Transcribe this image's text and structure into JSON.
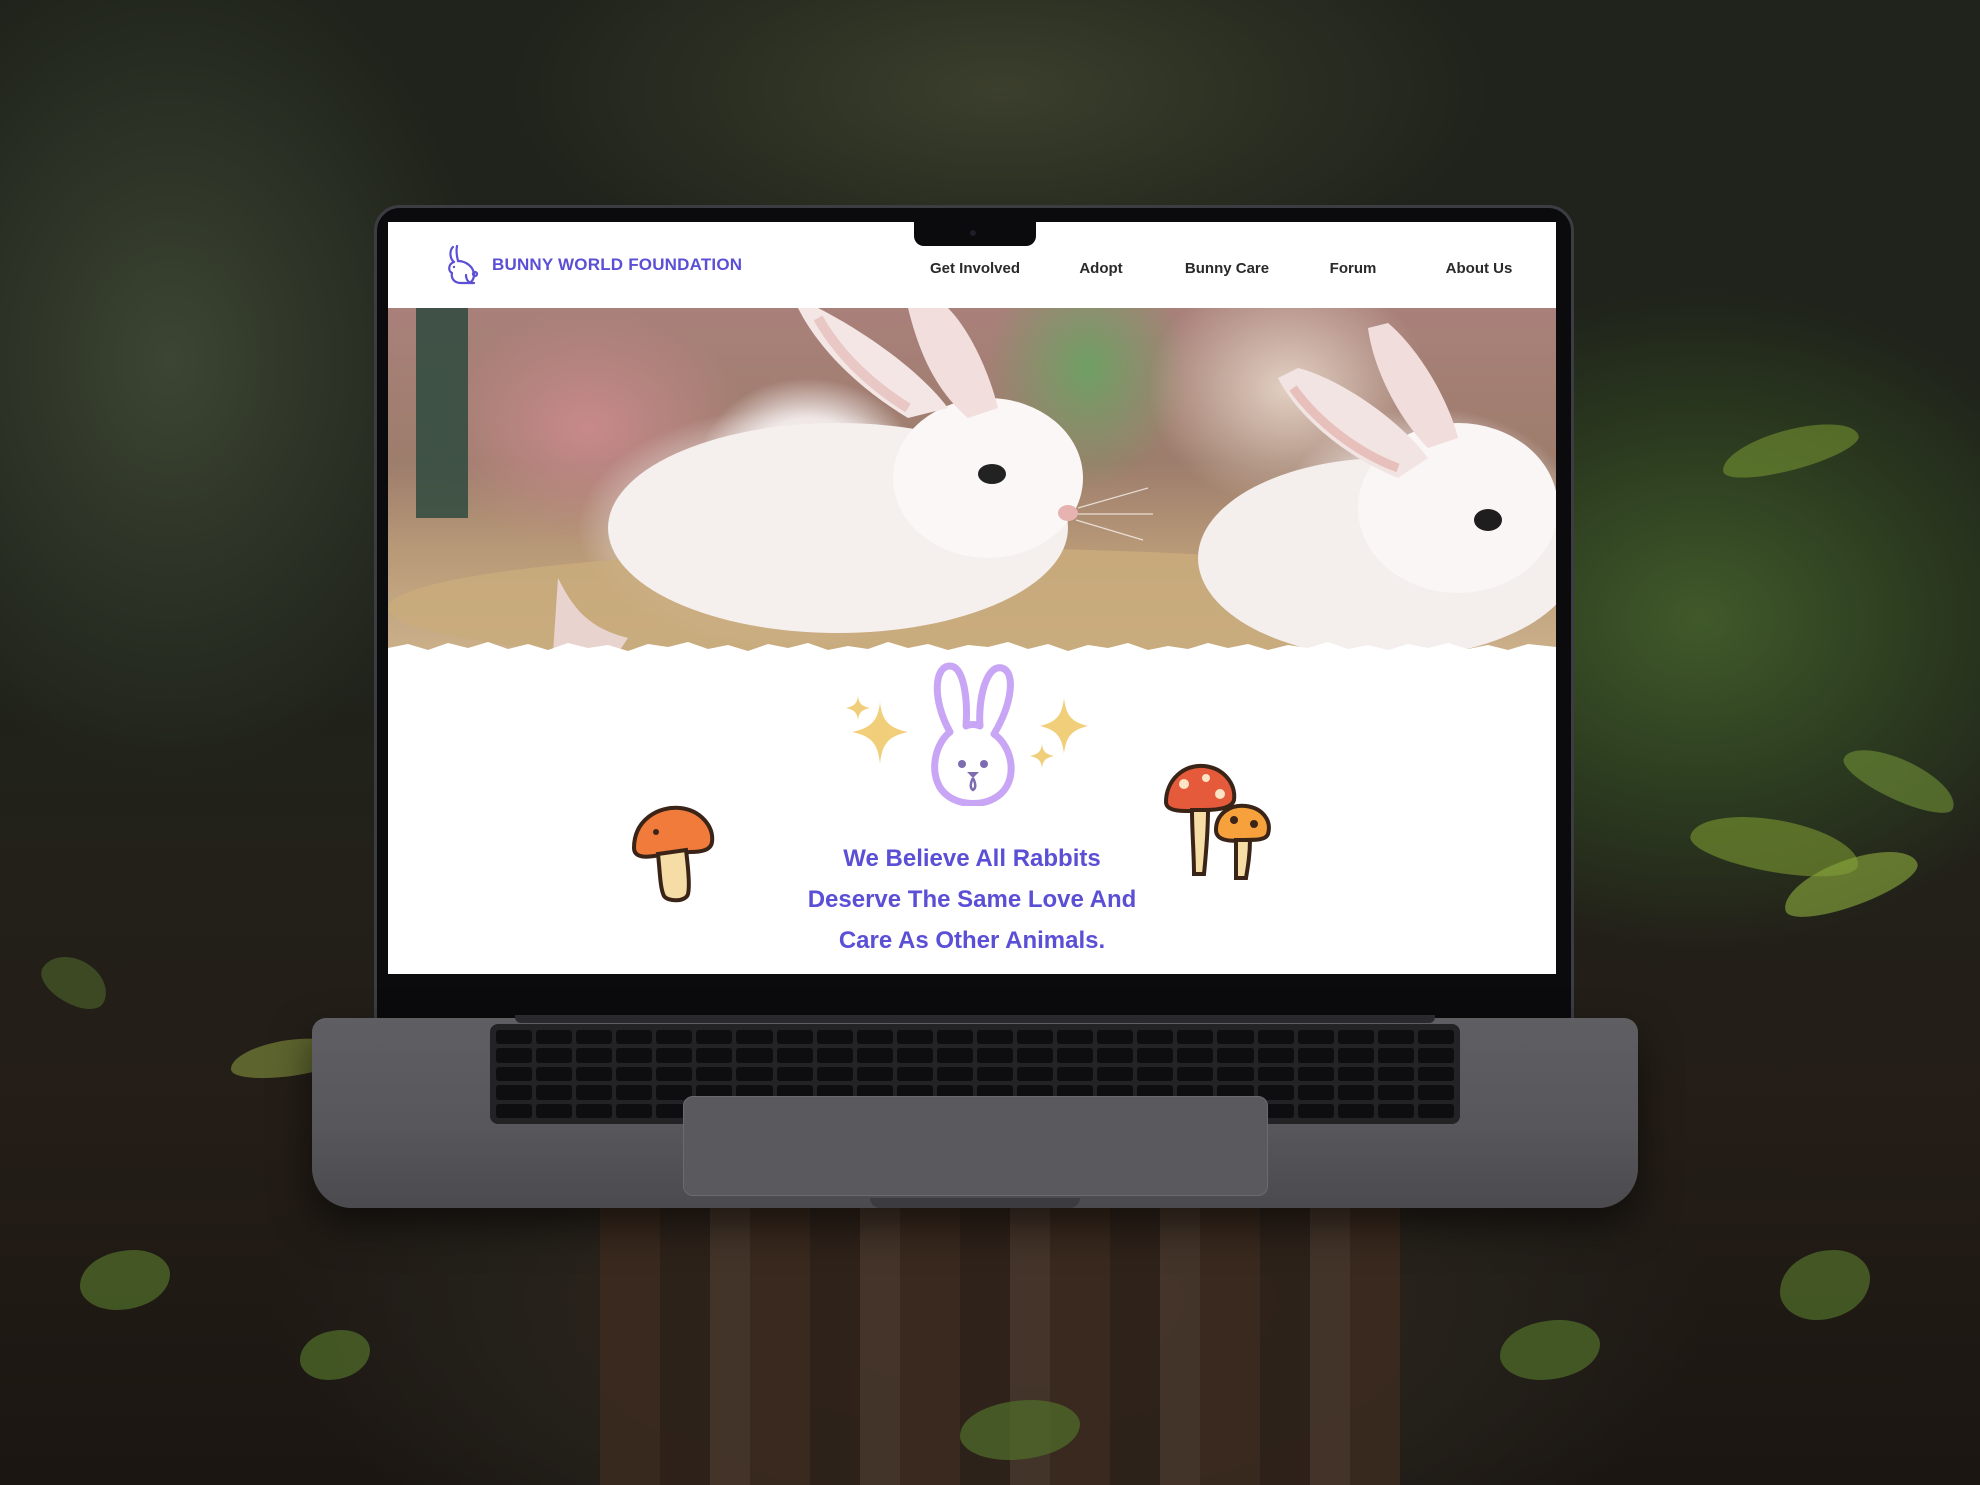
{
  "site": {
    "brand_name": "BUNNY WORLD FOUNDATION",
    "brand_color": "#5b4fd6",
    "logo_icon": "rabbit-icon"
  },
  "nav": {
    "items": [
      {
        "label": "Get Involved"
      },
      {
        "label": "Adopt"
      },
      {
        "label": "Bunny Care"
      },
      {
        "label": "Forum"
      },
      {
        "label": "About Us"
      }
    ]
  },
  "hero": {
    "image": "two-white-rabbits-photo"
  },
  "content": {
    "tagline_lines": [
      "We Believe All Rabbits",
      "Deserve The Same Love And",
      "Care As Other Animals."
    ],
    "icons": [
      "sparkle-icon",
      "bunny-face-icon",
      "mushroom-icon",
      "mushrooms-icon"
    ],
    "colors": {
      "sparkle": "#f1cf7a",
      "bunny_outline": "#c8a6f5",
      "mushroom_cap": "#f07b3a",
      "mushroom_cap_red": "#e45a3b"
    }
  }
}
